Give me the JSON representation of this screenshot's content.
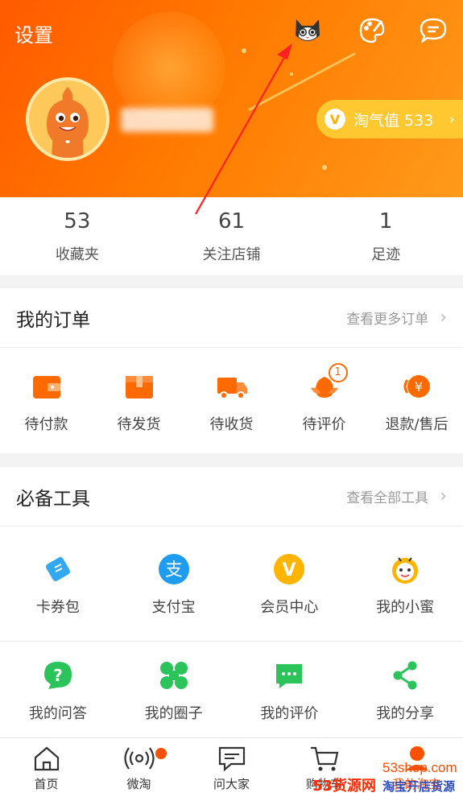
{
  "header": {
    "settings_label": "设置",
    "icons": [
      "cat-avatar-icon",
      "palette-icon",
      "message-icon"
    ],
    "score_badge": {
      "icon": "V",
      "label": "淘气值 533"
    }
  },
  "stats": [
    {
      "value": "53",
      "label": "收藏夹"
    },
    {
      "value": "61",
      "label": "关注店铺"
    },
    {
      "value": "1",
      "label": "足迹"
    }
  ],
  "orders": {
    "title": "我的订单",
    "more": "查看更多订单",
    "items": [
      {
        "label": "待付款",
        "icon": "wallet-icon"
      },
      {
        "label": "待发货",
        "icon": "box-icon"
      },
      {
        "label": "待收货",
        "icon": "truck-icon"
      },
      {
        "label": "待评价",
        "icon": "review-icon",
        "badge": "1"
      },
      {
        "label": "退款/售后",
        "icon": "refund-icon"
      }
    ]
  },
  "tools": {
    "title": "必备工具",
    "more": "查看全部工具",
    "row1": [
      {
        "label": "卡券包",
        "icon": "coupon-icon"
      },
      {
        "label": "支付宝",
        "icon": "alipay-icon"
      },
      {
        "label": "会员中心",
        "icon": "vip-icon"
      },
      {
        "label": "我的小蜜",
        "icon": "bee-icon"
      }
    ],
    "row2": [
      {
        "label": "我的问答",
        "icon": "question-icon"
      },
      {
        "label": "我的圈子",
        "icon": "circle-icon"
      },
      {
        "label": "我的评价",
        "icon": "comment-icon"
      },
      {
        "label": "我的分享",
        "icon": "share-icon"
      }
    ]
  },
  "tabbar": [
    {
      "label": "首页",
      "icon": "home-icon"
    },
    {
      "label": "微淘",
      "icon": "broadcast-icon"
    },
    {
      "label": "问大家",
      "icon": "chat-icon"
    },
    {
      "label": "购物车",
      "icon": "cart-icon"
    },
    {
      "label": "我的淘宝",
      "icon": "user-icon"
    }
  ],
  "watermark": {
    "site": "53shop.com",
    "brand": "53货源网",
    "slogan": "淘宝开店货源"
  },
  "colors": {
    "accent": "#ff5a00",
    "orange_icon": "#ff6a00",
    "green_icon": "#2bc45b",
    "blue_icon": "#32a8f0",
    "gold": "#ffc830"
  }
}
